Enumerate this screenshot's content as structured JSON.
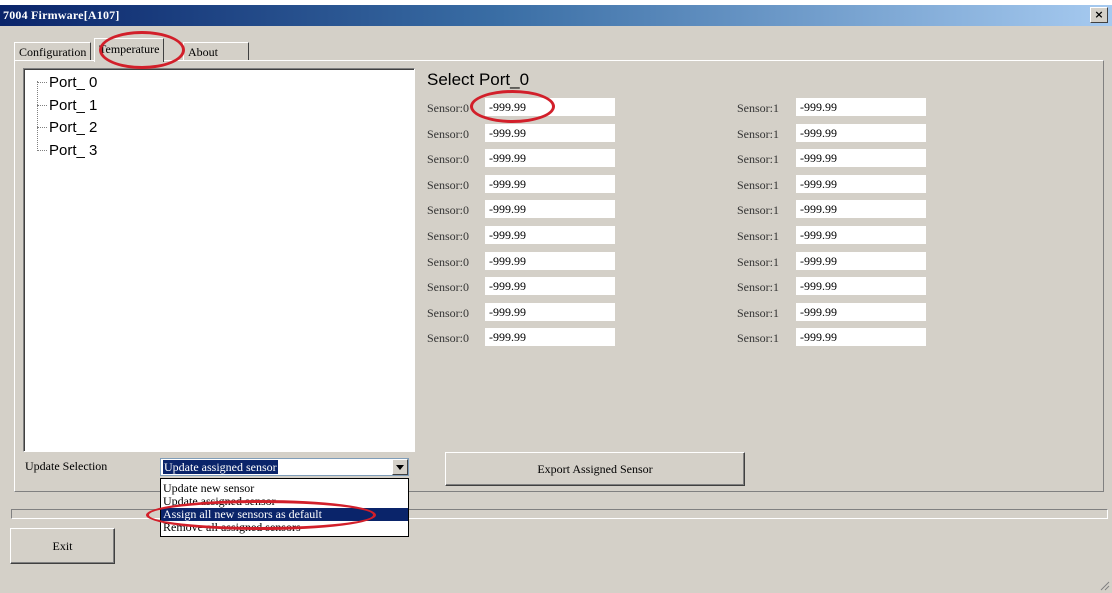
{
  "window": {
    "title": "7004 Firmware[A107]",
    "close_glyph": "×"
  },
  "tabs": [
    {
      "label": "Configuration"
    },
    {
      "label": "Temperature",
      "active": true
    },
    {
      "label": "About"
    }
  ],
  "tree": {
    "items": [
      "Port_ 0",
      "Port_ 1",
      "Port_ 2",
      "Port_ 3"
    ]
  },
  "sensors": {
    "title": "Select Port_0",
    "left_label": "Sensor:0",
    "right_label": "Sensor:1",
    "rows": [
      {
        "left": "-999.99",
        "right": "-999.99"
      },
      {
        "left": "-999.99",
        "right": "-999.99"
      },
      {
        "left": "-999.99",
        "right": "-999.99"
      },
      {
        "left": "-999.99",
        "right": "-999.99"
      },
      {
        "left": "-999.99",
        "right": "-999.99"
      },
      {
        "left": "-999.99",
        "right": "-999.99"
      },
      {
        "left": "-999.99",
        "right": "-999.99"
      },
      {
        "left": "-999.99",
        "right": "-999.99"
      },
      {
        "left": "-999.99",
        "right": "-999.99"
      },
      {
        "left": "-999.99",
        "right": "-999.99"
      }
    ]
  },
  "update": {
    "label": "Update Selection",
    "selected": "Update assigned sensor",
    "options": [
      "Update new sensor",
      "Update assigned sensor",
      "Assign all new sensors as default",
      "Remove all assigned sensors"
    ],
    "highlighted_index": 2
  },
  "export_button": "Export Assigned Sensor",
  "exit_button": "Exit",
  "colors": {
    "annotation": "#d21f2a",
    "selection": "#0a246a",
    "face": "#d4d0c8"
  }
}
